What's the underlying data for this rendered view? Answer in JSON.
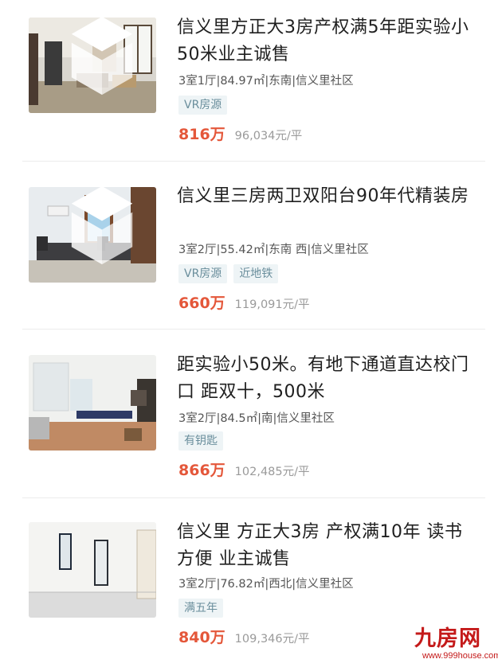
{
  "listings": [
    {
      "title": "信义里方正大3房产权满5年距实验小50米业主诚售",
      "layout_info": "3室1厅|84.97㎡|东南|信义里社区",
      "tags": [
        "VR房源"
      ],
      "price": "816万",
      "unit_price": "96,034元/平",
      "vr_badge": true
    },
    {
      "title": "信义里三房两卫双阳台90年代精装房",
      "layout_info": "3室2厅|55.42㎡|东南 西|信义里社区",
      "tags": [
        "VR房源",
        "近地铁"
      ],
      "price": "660万",
      "unit_price": "119,091元/平",
      "vr_badge": true
    },
    {
      "title": "距实验小50米。有地下通道直达校门口 距双十，500米",
      "layout_info": "3室2厅|84.5㎡|南|信义里社区",
      "tags": [
        "有钥匙"
      ],
      "price": "866万",
      "unit_price": "102,485元/平",
      "vr_badge": false
    },
    {
      "title": "信义里 方正大3房 产权满10年 读书方便 业主诚售",
      "layout_info": "3室2厅|76.82㎡|西北|信义里社区",
      "tags": [
        "满五年"
      ],
      "price": "840万",
      "unit_price": "109,346元/平",
      "vr_badge": false
    }
  ],
  "watermark": {
    "logo_text": "九房网",
    "url": "www.999house.com"
  },
  "colors": {
    "price": "#e4573a",
    "tag_bg": "#eef4f6",
    "tag_text": "#6a8e9c",
    "watermark": "#c41a1a"
  }
}
